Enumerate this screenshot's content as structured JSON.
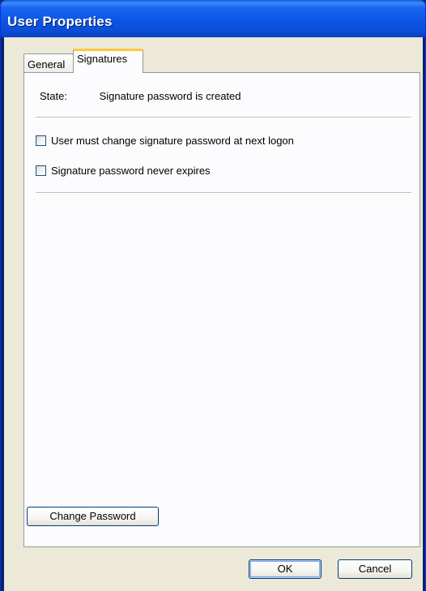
{
  "window": {
    "title": "User Properties"
  },
  "tabs": [
    {
      "label": "General",
      "selected": false
    },
    {
      "label": "Signatures",
      "selected": true
    }
  ],
  "signatures": {
    "state_label": "State:",
    "state_value": "Signature password is created",
    "checkboxes": [
      {
        "label": "User must change signature password at next logon",
        "checked": false
      },
      {
        "label": "Signature password never expires",
        "checked": false
      }
    ],
    "change_password_label": "Change Password"
  },
  "footer": {
    "ok_label": "OK",
    "cancel_label": "Cancel"
  },
  "colors": {
    "titlebar": "#0b55e4",
    "dialog_face": "#ece9d8",
    "tab_highlight": "#ffc83c",
    "panel_bg": "#fcfcfe"
  }
}
